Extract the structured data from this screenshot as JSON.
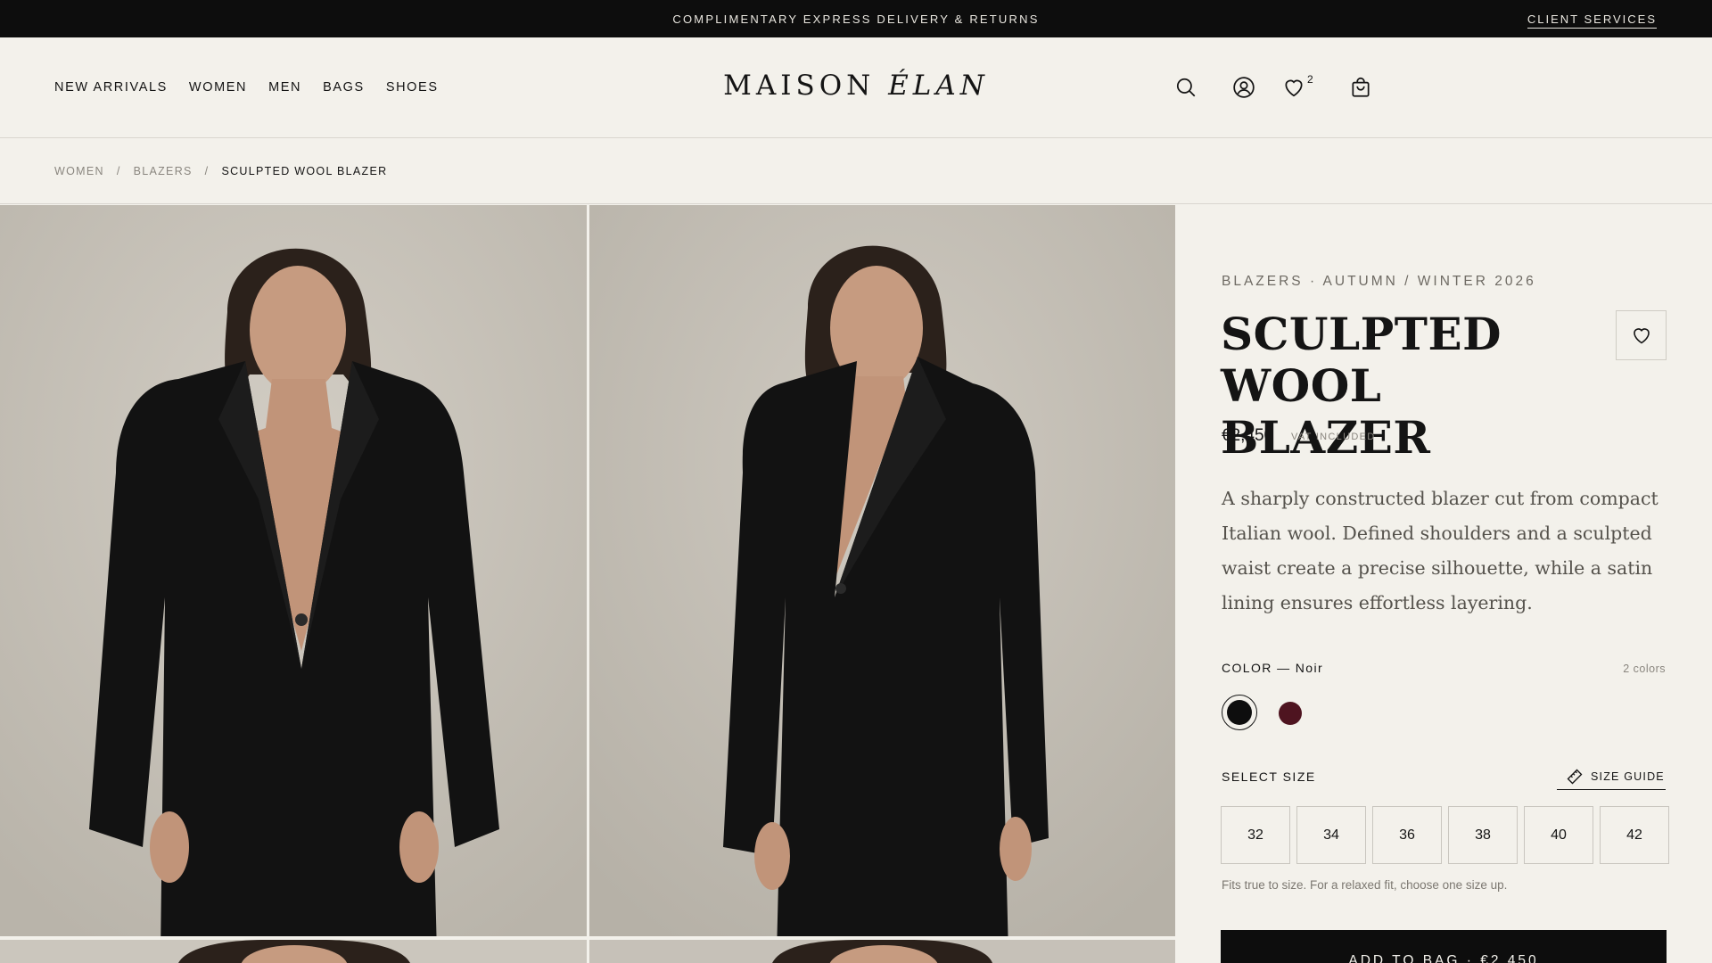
{
  "topbar": {
    "promo": "COMPLIMENTARY EXPRESS DELIVERY & RETURNS",
    "client_services": "CLIENT SERVICES"
  },
  "header": {
    "nav": [
      "NEW ARRIVALS",
      "WOMEN",
      "MEN",
      "BAGS",
      "SHOES"
    ],
    "logo_main": "MAISON",
    "logo_accent": "ÉLAN",
    "icons": [
      "search-icon",
      "account-icon",
      "heart-icon",
      "bag-icon"
    ],
    "wishlist_count": "2"
  },
  "breadcrumb": {
    "items": [
      "WOMEN",
      "BLAZERS"
    ],
    "separator": "/",
    "current": "SCULPTED WOOL BLAZER"
  },
  "product": {
    "eyebrow": "BLAZERS · AUTUMN / WINTER 2026",
    "title": "SCULPTED WOOL BLAZER",
    "price": "€2,450",
    "vat": "VAT INCLUDED",
    "description": "A sharply constructed blazer cut from compact Italian wool. Defined shoulders and a sculpted waist create a precise silhouette, while a satin lining ensures effortless layering.",
    "color_label": "COLOR — Noir",
    "color_count": "2 colors",
    "colors": [
      {
        "name": "Noir",
        "hex": "#0e0e0e",
        "selected": true
      },
      {
        "name": "Bordeaux",
        "hex": "#4e1420",
        "selected": false
      }
    ],
    "size_label": "SELECT SIZE",
    "size_guide": "SIZE GUIDE",
    "sizes": [
      "32",
      "34",
      "36",
      "38",
      "40",
      "42"
    ],
    "fit_note": "Fits true to size. For a relaxed fit, choose one size up.",
    "add_to_bag": "ADD TO BAG · €2,450"
  },
  "colors": {
    "announcement_bg": "#0d0d0d",
    "page_bg": "#f3f1eb",
    "photo_bg": "#c7c2b9",
    "garment": "#121212"
  }
}
